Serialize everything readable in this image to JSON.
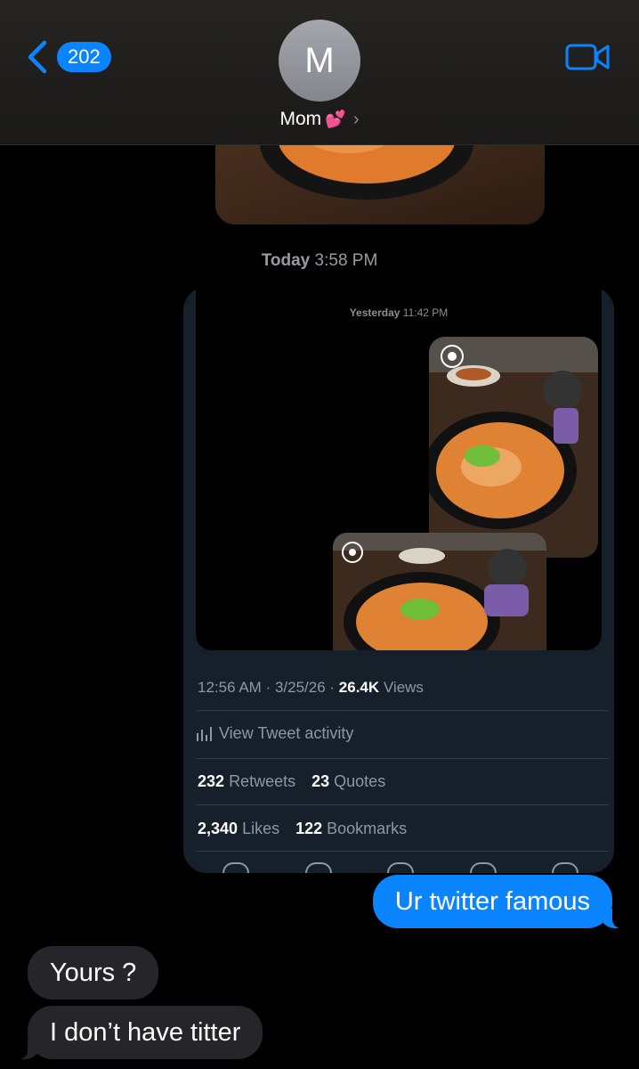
{
  "header": {
    "back_badge": "202",
    "avatar_initial": "M",
    "contact_name": "Mom",
    "contact_emoji": "💕",
    "accent_color": "#0a84ff",
    "icons": [
      "chevron-left-icon",
      "video-camera-icon",
      "chevron-right-icon"
    ]
  },
  "thread": {
    "timestamp_day": "Today",
    "timestamp_time": "3:58 PM"
  },
  "tweet": {
    "screenshot_day": "Yesterday",
    "screenshot_time": "11:42 PM",
    "time": "12:56 AM",
    "date": "3/25/26",
    "views_count": "26.4K",
    "views_label": "Views",
    "activity_label": "View Tweet activity",
    "retweets_count": "232",
    "retweets_label": "Retweets",
    "quotes_count": "23",
    "quotes_label": "Quotes",
    "likes_count": "2,340",
    "likes_label": "Likes",
    "bookmarks_count": "122",
    "bookmarks_label": "Bookmarks"
  },
  "messages": [
    {
      "from": "me",
      "text": "Ur twitter famous"
    },
    {
      "from": "them",
      "text": "Yours ?"
    },
    {
      "from": "them",
      "text": "I don’t have titter"
    }
  ]
}
